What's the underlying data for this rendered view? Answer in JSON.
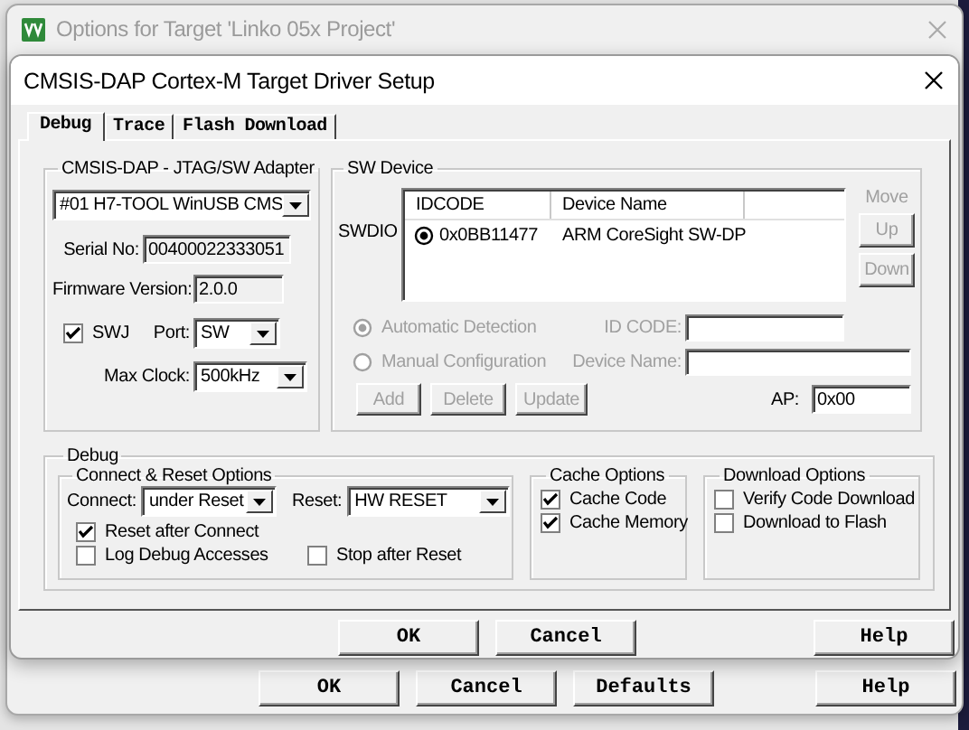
{
  "background_window": {
    "title": "Options for Target 'Linko 05x Project'",
    "buttons": [
      "OK",
      "Cancel",
      "Defaults",
      "Help"
    ]
  },
  "dialog": {
    "title": "CMSIS-DAP Cortex-M Target Driver Setup",
    "tabs": [
      {
        "label": "Debug",
        "selected": true
      },
      {
        "label": "Trace",
        "selected": false
      },
      {
        "label": "Flash Download",
        "selected": false
      }
    ],
    "adapter": {
      "title": "CMSIS-DAP - JTAG/SW Adapter",
      "device": "#01 H7-TOOL WinUSB CMS",
      "serial_label": "Serial No:",
      "serial": "00400022333051",
      "firmware_label": "Firmware Version:",
      "firmware": "2.0.0",
      "swj": {
        "label": "SWJ",
        "checked": true
      },
      "port_label": "Port:",
      "port": "SW",
      "clock_label": "Max Clock:",
      "clock": "500kHz"
    },
    "sw_device": {
      "title": "SW Device",
      "row_label": "SWDIO",
      "columns": [
        "IDCODE",
        "Device Name"
      ],
      "rows": [
        {
          "selected": true,
          "idcode": "0x0BB11477",
          "device_name": "ARM CoreSight SW-DP"
        }
      ],
      "move_label": "Move",
      "move_buttons": [
        {
          "label": "Up",
          "disabled": true
        },
        {
          "label": "Down",
          "disabled": true
        }
      ],
      "detection": [
        {
          "label": "Automatic Detection",
          "selected": true,
          "disabled": true
        },
        {
          "label": "Manual Configuration",
          "selected": false,
          "disabled": true
        }
      ],
      "id_code_label": "ID CODE:",
      "device_name_label": "Device Name:",
      "actions": [
        {
          "label": "Add",
          "disabled": true
        },
        {
          "label": "Delete",
          "disabled": true
        },
        {
          "label": "Update",
          "disabled": true
        }
      ],
      "ap_label": "AP:",
      "ap": "0x00"
    },
    "debug": {
      "title": "Debug",
      "connect_reset": {
        "title": "Connect & Reset Options",
        "connect_label": "Connect:",
        "connect": "under Reset",
        "reset_label": "Reset:",
        "reset": "HW RESET",
        "options": [
          {
            "label": "Reset after Connect",
            "checked": true
          },
          {
            "label": "Log Debug Accesses",
            "checked": false
          },
          {
            "label": "Stop after Reset",
            "checked": false
          }
        ]
      },
      "cache": {
        "title": "Cache Options",
        "options": [
          {
            "label": "Cache Code",
            "checked": true
          },
          {
            "label": "Cache Memory",
            "checked": true
          }
        ]
      },
      "download": {
        "title": "Download Options",
        "options": [
          {
            "label": "Verify Code Download",
            "checked": false
          },
          {
            "label": "Download to Flash",
            "checked": false
          }
        ]
      }
    },
    "buttons": [
      "OK",
      "Cancel",
      "Help"
    ]
  }
}
